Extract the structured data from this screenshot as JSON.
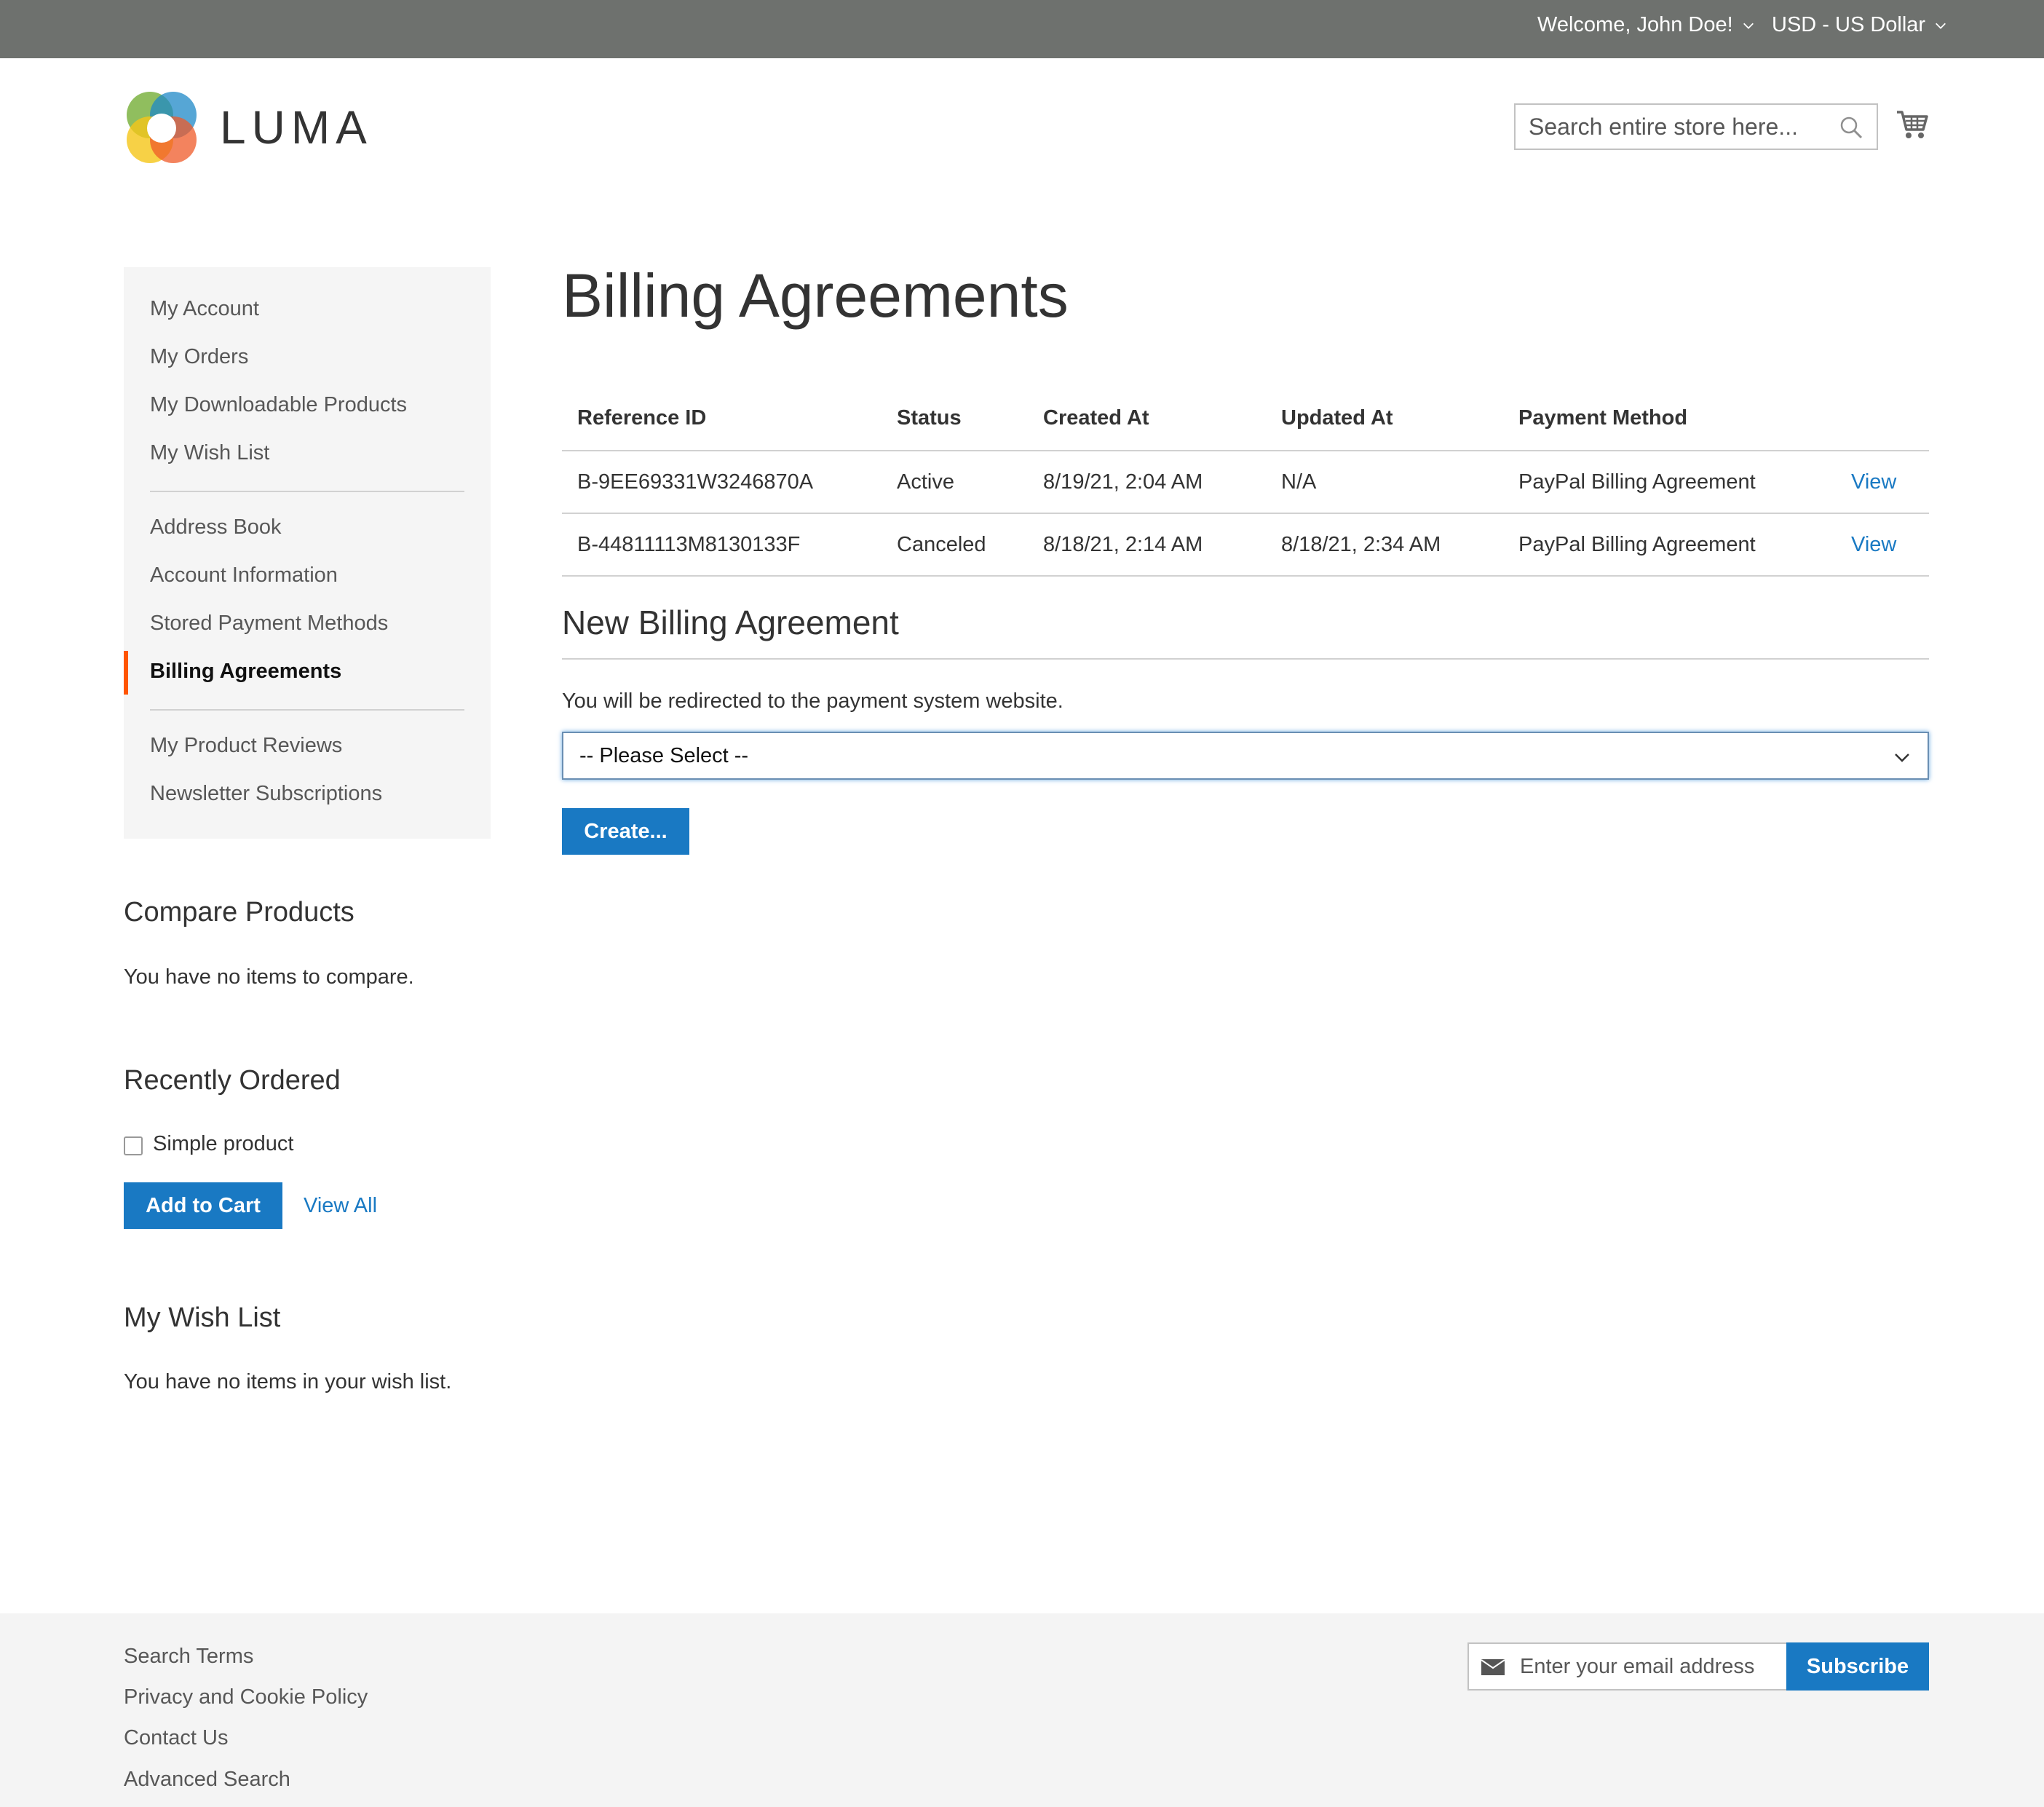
{
  "topbar": {
    "welcome": "Welcome, John Doe!",
    "currency": "USD - US Dollar"
  },
  "header": {
    "logo_text": "LUMA",
    "search_placeholder": "Search entire store here..."
  },
  "sidebar": {
    "nav_group1": [
      "My Account",
      "My Orders",
      "My Downloadable Products",
      "My Wish List"
    ],
    "nav_group2": [
      "Address Book",
      "Account Information",
      "Stored Payment Methods",
      "Billing Agreements"
    ],
    "nav_group3": [
      "My Product Reviews",
      "Newsletter Subscriptions"
    ],
    "current_item": "Billing Agreements",
    "compare": {
      "title": "Compare Products",
      "empty_text": "You have no items to compare."
    },
    "recently_ordered": {
      "title": "Recently Ordered",
      "item_label": "Simple product",
      "add_to_cart": "Add to Cart",
      "view_all": "View All"
    },
    "wishlist": {
      "title": "My Wish List",
      "empty_text": "You have no items in your wish list."
    }
  },
  "main": {
    "title": "Billing Agreements",
    "table": {
      "headers": [
        "Reference ID",
        "Status",
        "Created At",
        "Updated At",
        "Payment Method"
      ],
      "rows": [
        {
          "reference": "B-9EE69331W3246870A",
          "status": "Active",
          "created": "8/19/21, 2:04 AM",
          "updated": "N/A",
          "method": "PayPal Billing Agreement",
          "action": "View"
        },
        {
          "reference": "B-44811113M8130133F",
          "status": "Canceled",
          "created": "8/18/21, 2:14 AM",
          "updated": "8/18/21, 2:34 AM",
          "method": "PayPal Billing Agreement",
          "action": "View"
        }
      ]
    },
    "new_agreement": {
      "title": "New Billing Agreement",
      "note": "You will be redirected to the payment system website.",
      "select_value": "-- Please Select --",
      "create_button": "Create..."
    }
  },
  "footer": {
    "links": [
      "Search Terms",
      "Privacy and Cookie Policy",
      "Contact Us",
      "Advanced Search"
    ],
    "newsletter_placeholder": "Enter your email address",
    "subscribe_button": "Subscribe"
  },
  "colors": {
    "topbar": "#6e716e",
    "accent": "#1979c3",
    "current_marker": "#ff5501"
  }
}
